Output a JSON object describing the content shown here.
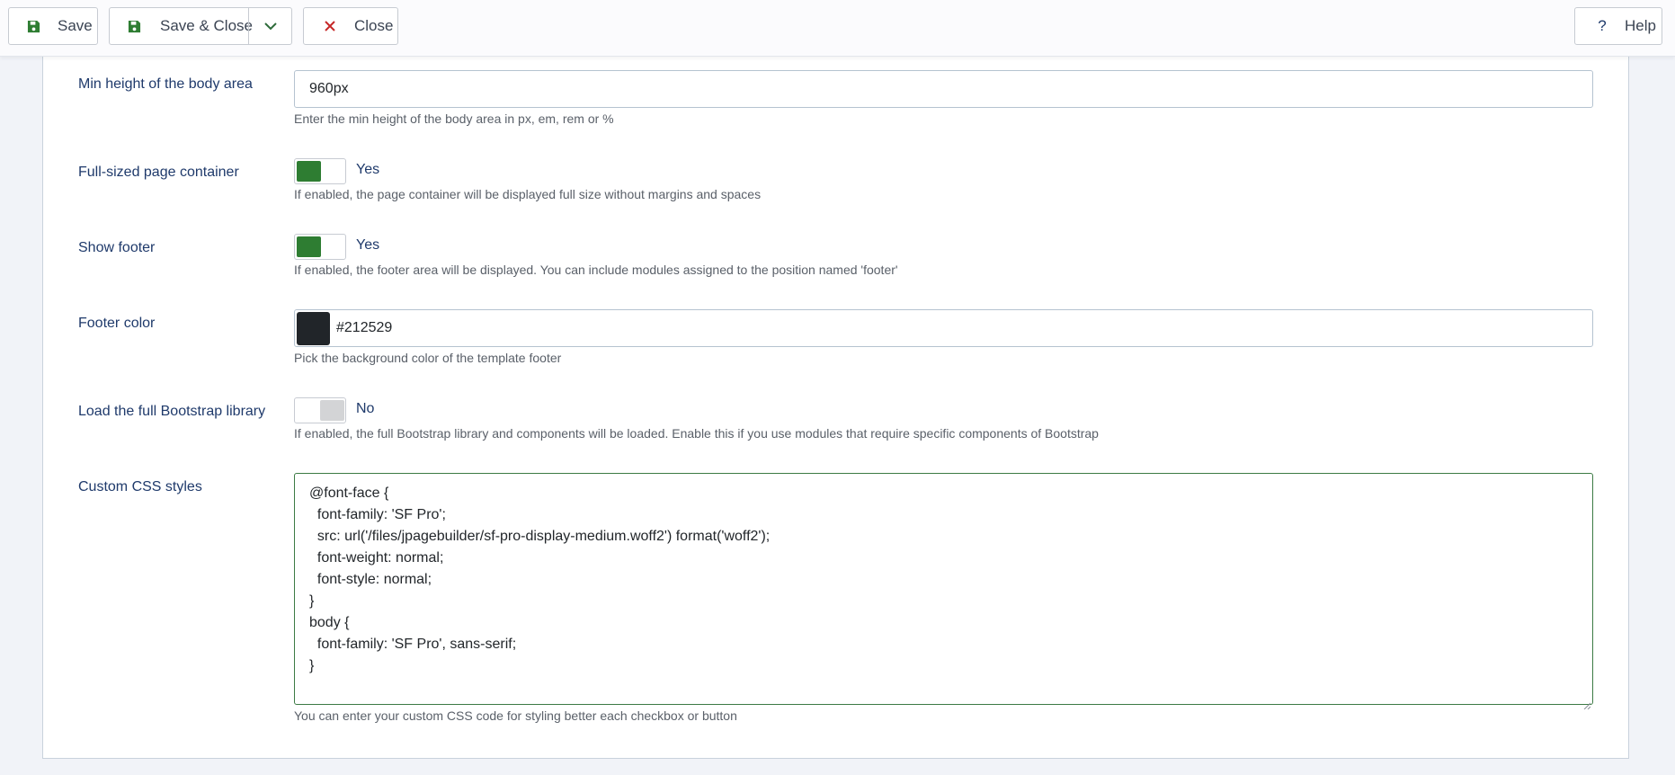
{
  "toolbar": {
    "save_label": "Save",
    "save_close_label": "Save & Close",
    "close_label": "Close",
    "help_label": "Help",
    "icons": {
      "save": "floppy-disk-icon",
      "dropdown": "chevron-down-icon",
      "close": "x-icon",
      "help": "question-icon"
    },
    "colors": {
      "save_icon": "#2e7d32",
      "close_icon": "#c62828"
    }
  },
  "fields": {
    "min_height": {
      "label": "Min height of the body area",
      "value": "960px",
      "description": "Enter the min height of the body area in px, em, rem or %"
    },
    "full_sized": {
      "label": "Full-sized page container",
      "state": "Yes",
      "enabled": true,
      "description": "If enabled, the page container will be displayed full size without margins and spaces"
    },
    "show_footer": {
      "label": "Show footer",
      "state": "Yes",
      "enabled": true,
      "description": "If enabled, the footer area will be displayed. You can include modules assigned to the position named 'footer'"
    },
    "footer_color": {
      "label": "Footer color",
      "value": "#212529",
      "swatch_color": "#212529",
      "description": "Pick the background color of the template footer"
    },
    "bootstrap": {
      "label": "Load the full Bootstrap library",
      "state": "No",
      "enabled": false,
      "description": "If enabled, the full Bootstrap library and components will be loaded. Enable this if you use modules that require specific components of Bootstrap"
    },
    "custom_css": {
      "label": "Custom CSS styles",
      "lines": [
        "@font-face {",
        "  font-family: 'SF Pro';",
        "  src: url('/files/jpagebuilder/sf-pro-display-medium.woff2') format('woff2');",
        "  font-weight: normal;",
        "  font-style: normal;",
        "}",
        "body {",
        "  font-family: 'SF Pro', sans-serif;",
        "}"
      ],
      "description": "You can enter your custom CSS code for styling better each checkbox or button"
    }
  },
  "colors": {
    "toggle_on": "#2e7d32",
    "toggle_off": "#d3d4d6",
    "label_text": "#1f3a6b"
  }
}
